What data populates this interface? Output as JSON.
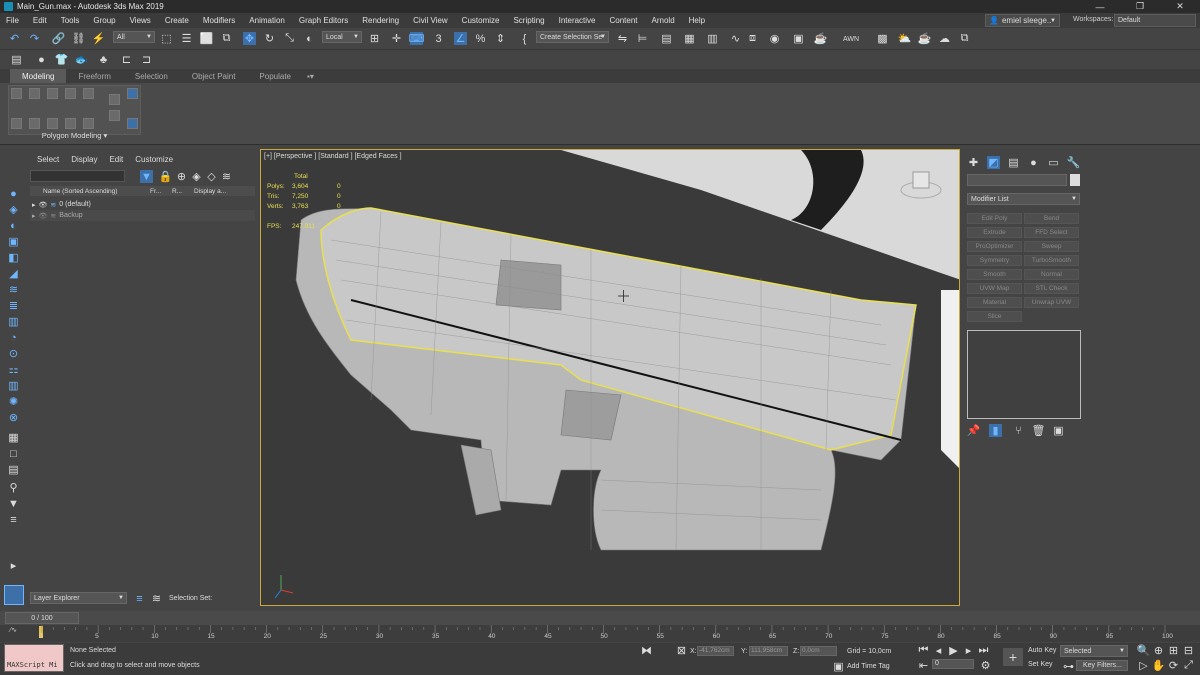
{
  "window": {
    "title": "Main_Gun.max - Autodesk 3ds Max 2019",
    "controls": [
      "—",
      "❐",
      "✕"
    ]
  },
  "menu": [
    "File",
    "Edit",
    "Tools",
    "Group",
    "Views",
    "Create",
    "Modifiers",
    "Animation",
    "Graph Editors",
    "Rendering",
    "Civil View",
    "Customize",
    "Scripting",
    "Interactive",
    "Content",
    "Arnold",
    "Help"
  ],
  "user": {
    "name": "emiel sleege..",
    "workspaces_label": "Workspaces:",
    "workspace": "Default"
  },
  "toolbar": {
    "filter": "All",
    "ref_coord": "Local",
    "selection_set": "Create Selection Se",
    "awn": "AWN"
  },
  "ribbon": {
    "tabs": [
      "Modeling",
      "Freeform",
      "Selection",
      "Object Paint",
      "Populate"
    ],
    "panel_label": "Polygon Modeling ▾"
  },
  "scene_explorer": {
    "menu": [
      "Select",
      "Display",
      "Edit",
      "Customize"
    ],
    "columns": [
      "Name (Sorted Ascending)",
      "Fr...",
      "R...",
      "Display a..."
    ],
    "rows": [
      "0 (default)",
      "Backup"
    ],
    "footer_label": "Layer Explorer",
    "selection_set": "Selection Set:"
  },
  "viewport": {
    "label": "[+] [Perspective ] [Standard ] [Edged Faces ]",
    "stats": {
      "total": "Total",
      "polys_label": "Polys:",
      "polys": "3,604",
      "polys_sel": "0",
      "tris_label": "Tris:",
      "tris": "7,250",
      "tris_sel": "0",
      "verts_label": "Verts:",
      "verts": "3,763",
      "verts_sel": "0",
      "fps_label": "FPS:",
      "fps": "247.911"
    }
  },
  "command_panel": {
    "modifier_list": "Modifier List",
    "modifiers": [
      "Edit Poly",
      "Bend",
      "Extrude",
      "FFD Select",
      "ProOptimizer",
      "Sweep",
      "Symmetry",
      "TurboSmooth",
      "Smooth",
      "Normal",
      "UVW Map",
      "STL Check",
      "Material",
      "Unwrap UVW",
      "Slice"
    ]
  },
  "timeline": {
    "frame": "0 / 100",
    "ticks": [
      "0",
      "5",
      "10",
      "15",
      "20",
      "25",
      "30",
      "35",
      "40",
      "45",
      "50",
      "55",
      "60",
      "65",
      "70",
      "75",
      "80",
      "85",
      "90",
      "95",
      "100"
    ]
  },
  "status": {
    "maxscript": "MAXScript Mi",
    "selection": "None Selected",
    "prompt": "Click and drag to select and move objects",
    "x_label": "X:",
    "x": "-41,762cm",
    "y_label": "Y:",
    "y": "111,958cm",
    "z_label": "Z:",
    "z": "0,0cm",
    "grid": "Grid = 10,0cm",
    "add_time_tag": "Add Time Tag",
    "auto_key": "Auto Key",
    "set_key": "Set Key",
    "selected": "Selected",
    "key_filters": "Key Filters...",
    "frame_field": "0"
  },
  "colors": {
    "accent": "#c9a93a",
    "blue_icon": "#6fb6ff",
    "selection_yellow": "#e8e050"
  }
}
